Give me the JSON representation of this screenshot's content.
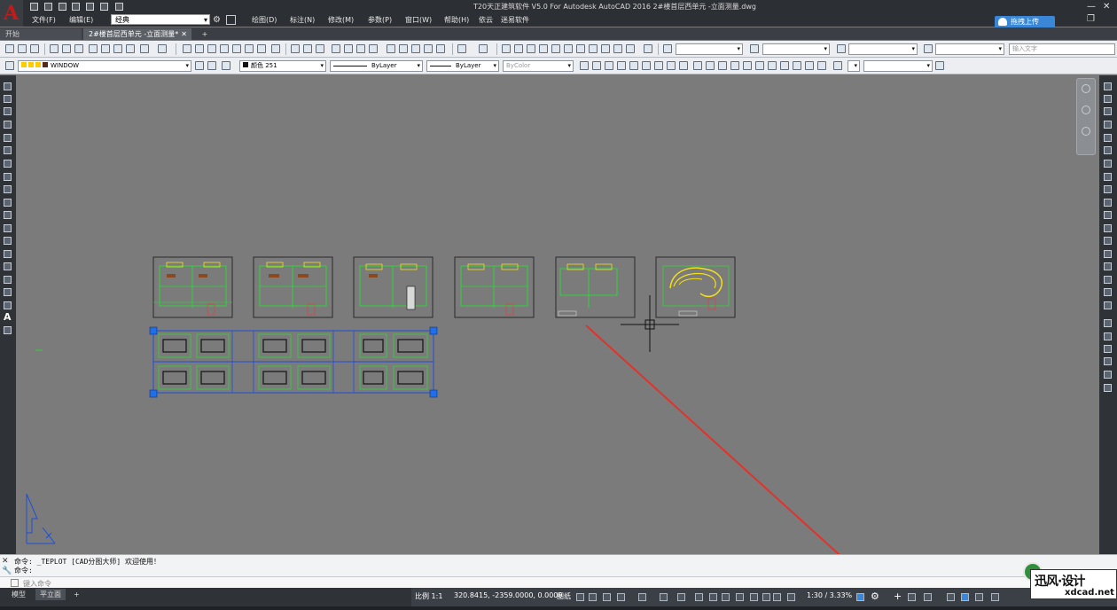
{
  "titlebar": {
    "app_logo": "A",
    "workspace": "经典",
    "title": "T20天正建筑软件 V5.0 For Autodesk AutoCAD 2016    2#楼首层西单元 -立面测量.dwg",
    "upload_label": "拖拽上传",
    "menus": [
      "文件(F)",
      "编辑(E)",
      "绘图(D)",
      "标注(N)",
      "修改(M)",
      "参数(P)",
      "窗口(W)",
      "帮助(H)",
      "依云",
      "迷易软件"
    ],
    "window_controls": [
      "—",
      "❐",
      "✕"
    ]
  },
  "tabs": {
    "start": "开始",
    "document": "2#楼首层西单元 -立面测量*",
    "close": "✕",
    "add": "+"
  },
  "toolbar": {
    "layer": "WINDOW",
    "color": "颜色 251",
    "linetype": "ByLayer",
    "lineweight": "ByLayer",
    "plotstyle": "ByColor",
    "text_input_placeholder": "输入文字"
  },
  "command": {
    "history": [
      "命令: _TEPLOT [CAD分图大师] 欢迎使用！",
      "命令:"
    ],
    "input_placeholder": "键入命令"
  },
  "status": {
    "layout_tabs": [
      "模型",
      "平立面",
      "+"
    ],
    "scale": "比例 1:1",
    "coords": "320.8415, -2359.0000, 0.0000",
    "paper_label": "图纸",
    "annotation_scale": "1:30 / 3.33%"
  },
  "watermark": {
    "logo_text": "迅风·设计",
    "url": "xdcad.net"
  },
  "colors": {
    "title_bg": "#2c2f34",
    "canvas_bg": "#7b7b7b",
    "selection_blue": "#1c4fd6",
    "grip_blue": "#1f6fe8",
    "arrow_red": "#e2322b",
    "plan_green": "#2fd63a",
    "plan_yellow": "#f3df1a"
  },
  "icons": {
    "app": "autocad-logo-icon",
    "gear": "gear-icon",
    "cloud": "cloud-upload-icon",
    "ucs": "ucs-icon",
    "crosshair": "crosshair-cursor-icon"
  }
}
